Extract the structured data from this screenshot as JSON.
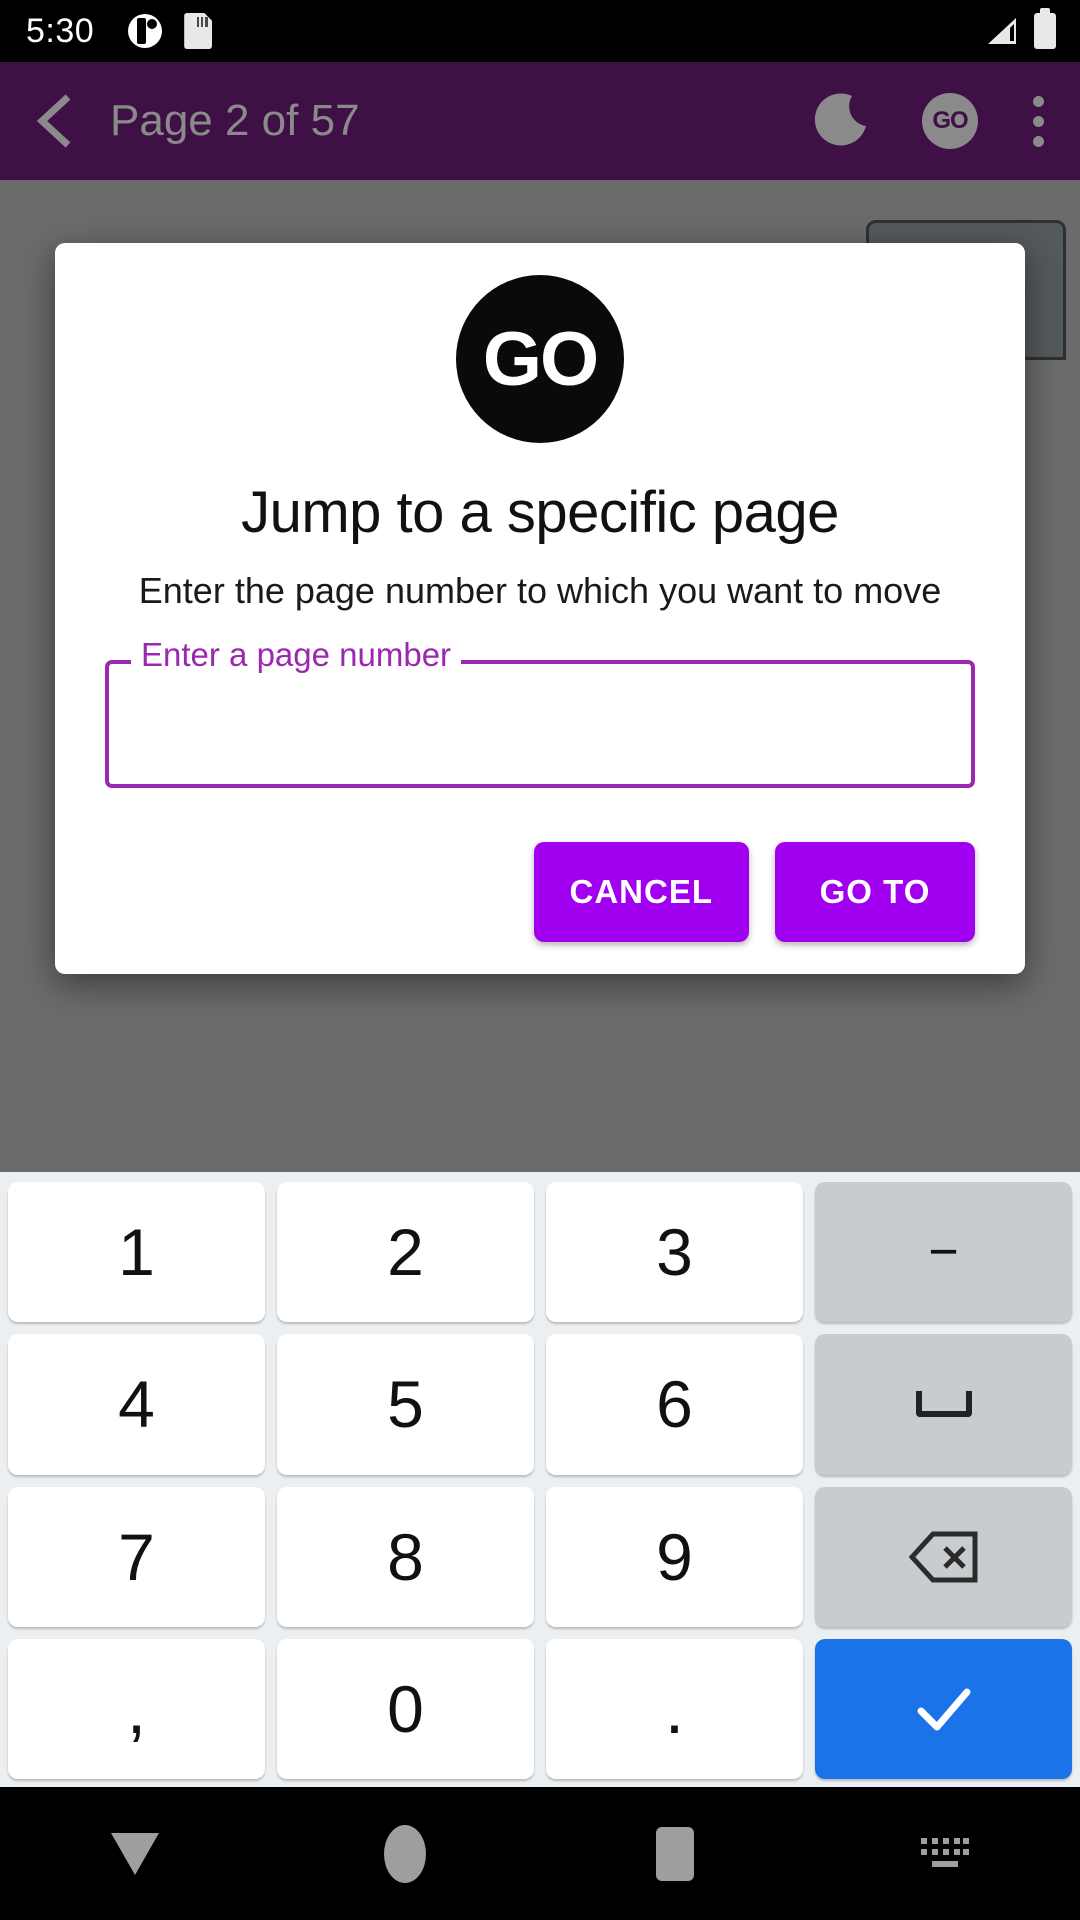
{
  "status_bar": {
    "time": "5:30",
    "icons": [
      "app-circle-icon",
      "sd-card-icon"
    ],
    "right_icons": [
      "signal-icon",
      "battery-icon"
    ]
  },
  "app_bar": {
    "back_icon": "chevron-left-icon",
    "title": "Page 2 of 57",
    "actions": [
      {
        "name": "night-mode-icon",
        "label": ""
      },
      {
        "name": "go-to-page-icon",
        "label": "GO"
      },
      {
        "name": "overflow-menu-icon",
        "label": ""
      }
    ],
    "bg_color": "#3f1046",
    "text_color": "#8a8a8a"
  },
  "dialog": {
    "logo_text": "GO",
    "title": "Jump to a specific page",
    "subtitle": "Enter the page number to which you want to move",
    "field": {
      "label": "Enter a page number",
      "value": "",
      "placeholder": ""
    },
    "buttons": {
      "cancel": "CANCEL",
      "confirm": "GO TO"
    },
    "accent_color": "#9c27b0",
    "button_color": "#a100f0"
  },
  "keyboard": {
    "rows": [
      [
        {
          "label": "1",
          "type": "digit"
        },
        {
          "label": "2",
          "type": "digit"
        },
        {
          "label": "3",
          "type": "digit"
        },
        {
          "label": "−",
          "type": "fn",
          "name": "minus-key"
        }
      ],
      [
        {
          "label": "4",
          "type": "digit"
        },
        {
          "label": "5",
          "type": "digit"
        },
        {
          "label": "6",
          "type": "digit"
        },
        {
          "label": "",
          "type": "fn",
          "name": "space-key"
        }
      ],
      [
        {
          "label": "7",
          "type": "digit"
        },
        {
          "label": "8",
          "type": "digit"
        },
        {
          "label": "9",
          "type": "digit"
        },
        {
          "label": "",
          "type": "fn",
          "name": "backspace-key"
        }
      ],
      [
        {
          "label": ",",
          "type": "punct"
        },
        {
          "label": "0",
          "type": "digit"
        },
        {
          "label": ".",
          "type": "punct"
        },
        {
          "label": "",
          "type": "enter",
          "name": "enter-key"
        }
      ]
    ],
    "bg_color": "#eceff1",
    "enter_color": "#1a73e8"
  },
  "nav_bar": {
    "buttons": [
      {
        "name": "nav-back-button"
      },
      {
        "name": "nav-home-button"
      },
      {
        "name": "nav-recents-button"
      },
      {
        "name": "nav-keyboard-switch-button"
      }
    ]
  }
}
